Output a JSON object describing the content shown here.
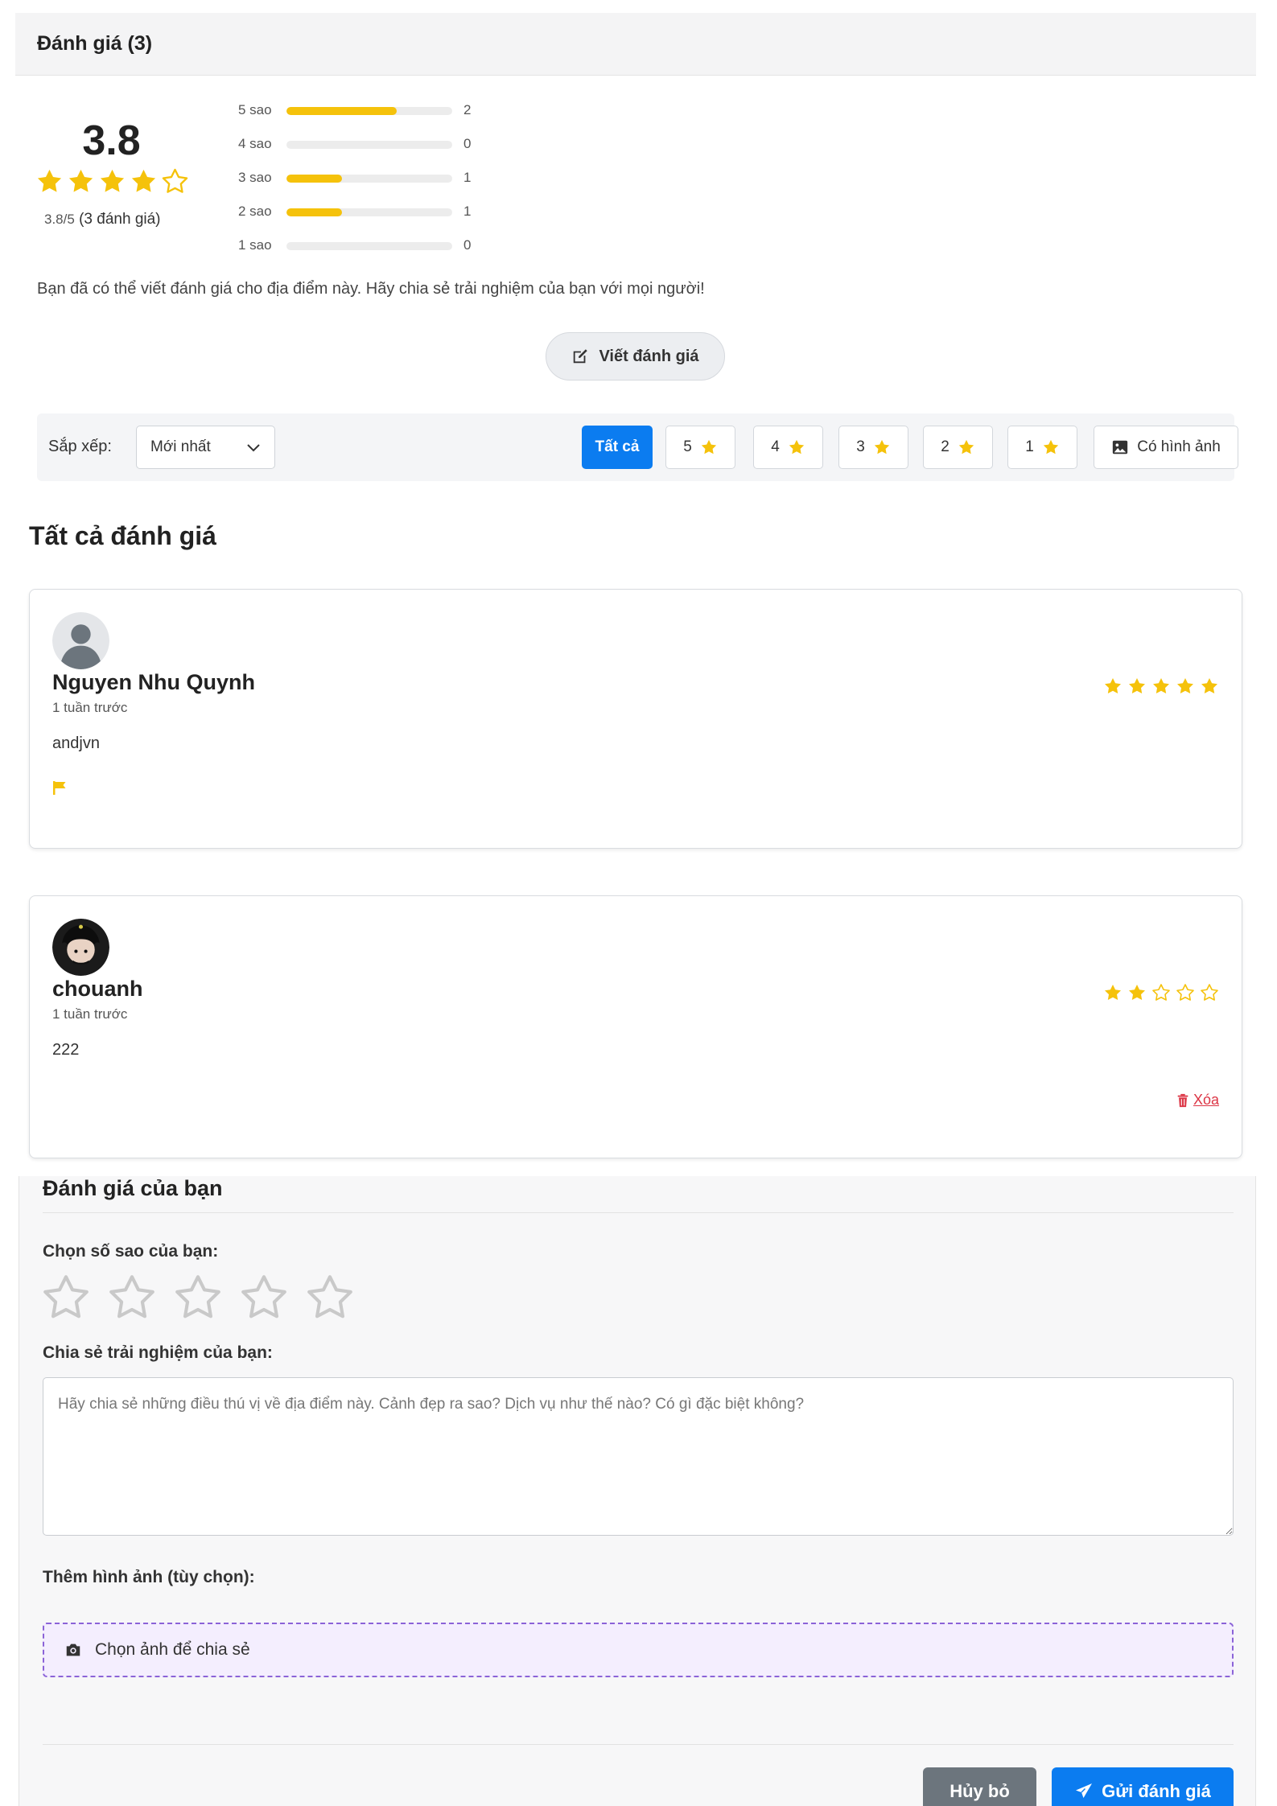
{
  "header": {
    "title": "Đánh giá (3)"
  },
  "summary": {
    "average": "3.8",
    "average_value": 3.8,
    "stars": [
      "full",
      "full",
      "full",
      "full",
      "empty"
    ],
    "ratio_text": "3.8/5",
    "count_text": "(3 đánh giá)"
  },
  "distribution": [
    {
      "label": "5 sao",
      "count": "2",
      "fraction": 0.667
    },
    {
      "label": "4 sao",
      "count": "0",
      "fraction": 0
    },
    {
      "label": "3 sao",
      "count": "1",
      "fraction": 0.333
    },
    {
      "label": "2 sao",
      "count": "1",
      "fraction": 0.333
    },
    {
      "label": "1 sao",
      "count": "0",
      "fraction": 0
    }
  ],
  "invite_text": "Bạn đã có thể viết đánh giá cho địa điểm này. Hãy chia sẻ trải nghiệm của bạn với mọi người!",
  "write_button": "Viết đánh giá",
  "filter": {
    "sort_label": "Sắp xếp:",
    "sort_value": "Mới nhất",
    "buttons": [
      {
        "label": "Tất cả",
        "active": true
      },
      {
        "label": "5"
      },
      {
        "label": "4"
      },
      {
        "label": "3"
      },
      {
        "label": "2"
      },
      {
        "label": "1"
      },
      {
        "label": "Có hình ảnh"
      }
    ]
  },
  "section_title": "Tất cả đánh giá",
  "reviews": [
    {
      "name": "Nguyen Nhu Quynh",
      "time": "1 tuần trước",
      "content": "andjvn",
      "rating": 5,
      "avatar": "default-user-avatar"
    },
    {
      "name": "chouanh",
      "time": "1 tuần trước",
      "content": "222",
      "rating": 2,
      "avatar": "user-photo-avatar",
      "delete_label": "Xóa"
    }
  ],
  "form": {
    "title": "Đánh giá của bạn",
    "stars_label": "Chọn số sao của bạn:",
    "experience_label": "Chia sẻ trải nghiệm của bạn:",
    "placeholder": "Hãy chia sẻ những điều thú vị về địa điểm này. Cảnh đẹp ra sao? Dịch vụ như thế nào? Có gì đặc biệt không?",
    "images_label": "Thêm hình ảnh (tùy chọn):",
    "upload_label": "Chọn ảnh để chia sẻ",
    "cancel_label": "Hủy bỏ",
    "submit_label": "Gửi đánh giá"
  },
  "colors": {
    "star": "#f5c20b",
    "primary": "#0b7cf0",
    "danger": "#dc3545",
    "secondary": "#6c757d"
  }
}
